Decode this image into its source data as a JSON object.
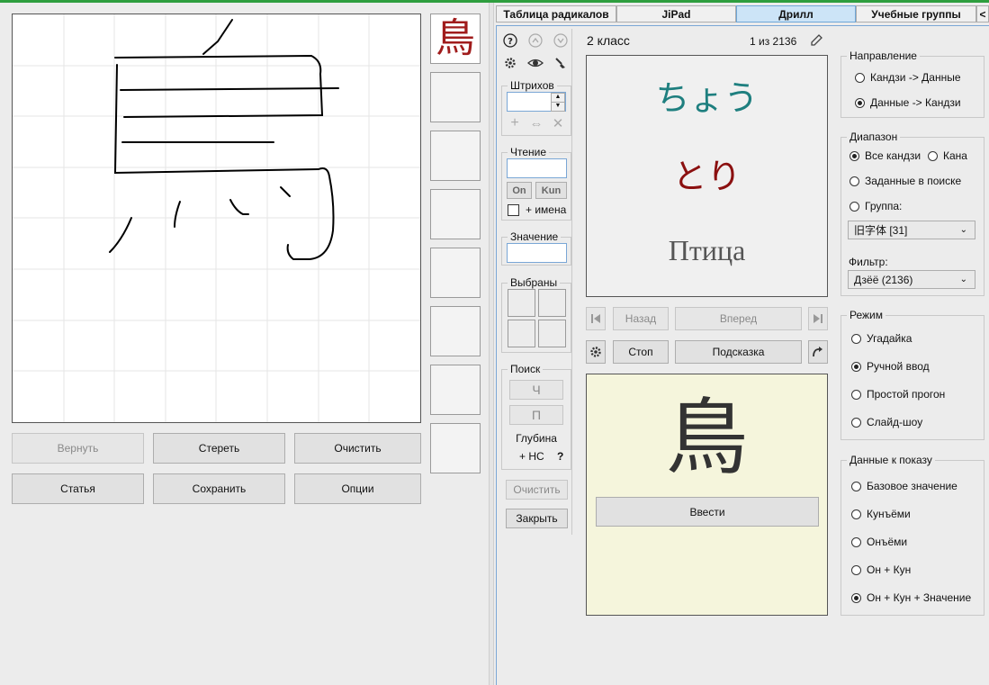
{
  "tabs": {
    "radicals": "Таблица радикалов",
    "jipad": "JiPad",
    "drill": "Дрилл",
    "groups": "Учебные группы",
    "nav_left": "<"
  },
  "canvas_buttons": {
    "undo": "Вернуть",
    "erase": "Стереть",
    "clear": "Очистить",
    "article": "Статья",
    "save": "Сохранить",
    "options": "Опции"
  },
  "candidate_kanji": "鳥",
  "search_panel": {
    "strokes_label": "Штрихов",
    "reading_label": "Чтение",
    "on_button": "On",
    "kun_button": "Kun",
    "names_label": "+ имена",
    "meaning_label": "Значение",
    "selected_label": "Выбраны",
    "search_label": "Поиск",
    "search_ch": "Ч",
    "search_p": "П",
    "depth_label": "Глубина",
    "depth_value": "+ НС",
    "help": "?",
    "clear_button": "Очистить",
    "close_button": "Закрыть"
  },
  "drill": {
    "class_label": "2 класс",
    "counter": "1 из 2136",
    "reading_on": "ちょう",
    "reading_kun": "とり",
    "meaning": "Птица",
    "back": "Назад",
    "forward": "Вперед",
    "stop": "Стоп",
    "hint": "Подсказка",
    "answer_kanji": "鳥",
    "enter": "Ввести"
  },
  "direction": {
    "legend": "Направление",
    "opt1": "Кандзи -> Данные",
    "opt2": "Данные -> Кандзи"
  },
  "range": {
    "legend": "Диапазон",
    "all_kanji": "Все кандзи",
    "kana": "Кана",
    "search_set": "Заданные в поиске",
    "group": "Группа:",
    "group_select": "旧字体 [31]",
    "filter_label": "Фильтр:",
    "filter_select": "Дзёё (2136)"
  },
  "mode": {
    "legend": "Режим",
    "guess": "Угадайка",
    "manual": "Ручной ввод",
    "simple": "Простой прогон",
    "slideshow": "Слайд-шоу"
  },
  "display": {
    "legend": "Данные к показу",
    "base": "Базовое значение",
    "kunyomi": "Кунъёми",
    "onyomi": "Онъёми",
    "on_kun": "Он + Кун",
    "on_kun_meaning": "Он + Кун + Значение"
  },
  "colors": {
    "accent_teal": "#1e7f7f",
    "accent_red": "#8b1010",
    "kanji_red": "#a01c1c",
    "answer_bg": "#f5f5dc",
    "active_tab": "#cce4f7",
    "top_bar_green": "#2e9e3e"
  }
}
